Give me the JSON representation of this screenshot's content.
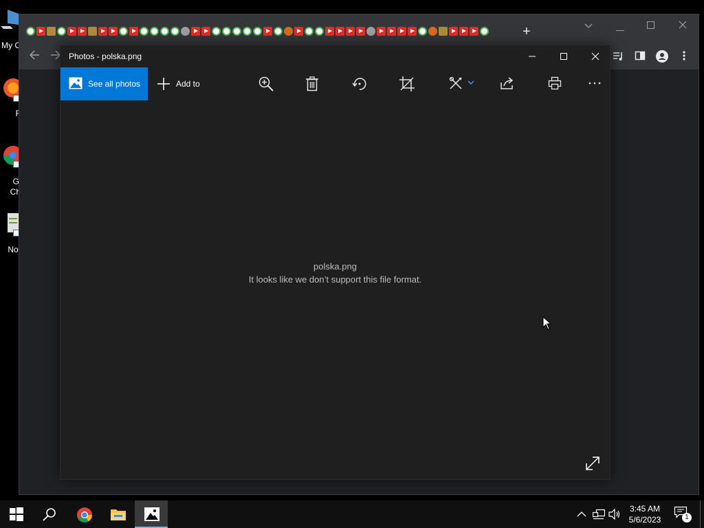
{
  "desktop": {
    "icons": [
      {
        "label": "My C",
        "icon": "my-computer-icon"
      },
      {
        "label": "F",
        "icon": "firefox-icon"
      },
      {
        "label": "G",
        "label2": "Ch",
        "icon": "google-chrome-icon"
      },
      {
        "label": "Not",
        "icon": "notepad-icon"
      }
    ]
  },
  "chrome": {
    "new_tab_label": "+",
    "tab_favicons": [
      "google",
      "youtube",
      "image",
      "google",
      "youtube",
      "youtube",
      "image",
      "youtube",
      "youtube",
      "google",
      "youtube",
      "google",
      "google",
      "google",
      "google",
      "gray",
      "youtube",
      "youtube",
      "google",
      "google",
      "google",
      "google",
      "google",
      "youtube",
      "google",
      "burger",
      "youtube",
      "google",
      "google",
      "youtube",
      "youtube",
      "youtube",
      "youtube",
      "gray",
      "youtube",
      "youtube",
      "youtube",
      "youtube",
      "google",
      "burger",
      "image",
      "youtube",
      "youtube",
      "youtube",
      "google"
    ]
  },
  "photos": {
    "title": "Photos - polska.png",
    "toolbar": {
      "see_all_label": "See all photos",
      "add_to_label": "Add to",
      "tools": [
        "zoom-icon",
        "delete-icon",
        "rotate-icon",
        "crop-icon",
        "edit-icon",
        "share-icon",
        "print-icon",
        "more-icon"
      ]
    },
    "message": {
      "filename": "polska.png",
      "text": "It looks like we don’t support this file format."
    }
  },
  "taskbar": {
    "apps": [
      "start-button",
      "search-button",
      "chrome-taskbar-icon",
      "file-explorer-taskbar-icon",
      "photos-taskbar-icon"
    ],
    "clock": {
      "time": "3:45 AM",
      "date": "5/6/2023"
    },
    "notification_count": "1"
  },
  "colors": {
    "accent": "#0078d7",
    "photos_bg": "#1f1f1f",
    "chrome_frame": "#35363a",
    "taskbar": "#101010"
  }
}
